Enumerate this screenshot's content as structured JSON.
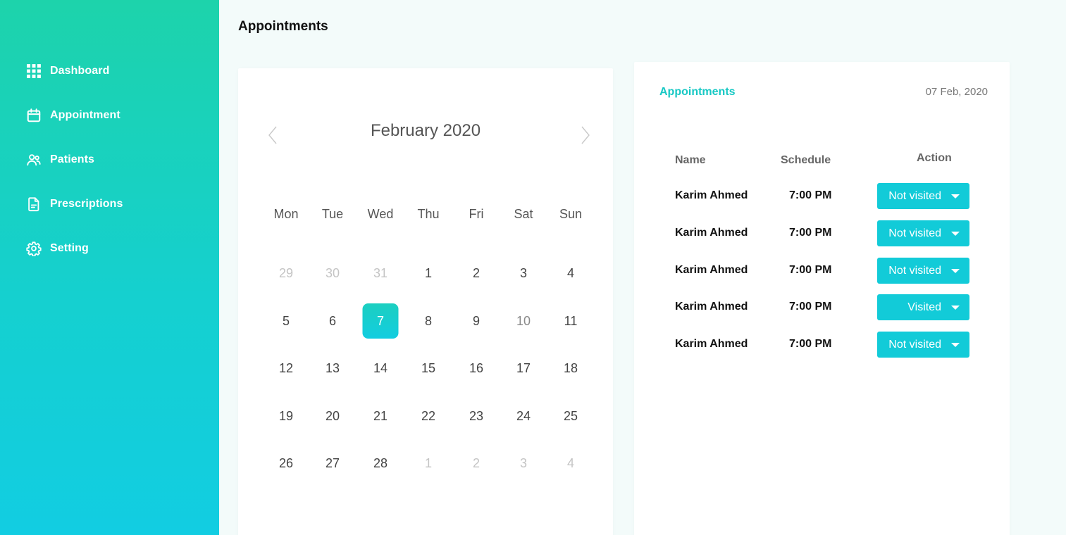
{
  "sidebar": {
    "items": [
      {
        "label": "Dashboard",
        "icon": "grid-icon"
      },
      {
        "label": "Appointment",
        "icon": "calendar-icon"
      },
      {
        "label": "Patients",
        "icon": "users-icon"
      },
      {
        "label": "Prescriptions",
        "icon": "document-icon"
      },
      {
        "label": "Setting",
        "icon": "gear-icon"
      }
    ]
  },
  "page": {
    "title": "Appointments"
  },
  "calendar": {
    "month_label": "February 2020",
    "weekdays": [
      "Mon",
      "Tue",
      "Wed",
      "Thu",
      "Fri",
      "Sat",
      "Sun"
    ],
    "selected_day": "7",
    "weeks": [
      [
        "29",
        "30",
        "31",
        "1",
        "2",
        "3",
        "4"
      ],
      [
        "5",
        "6",
        "7",
        "8",
        "9",
        "10",
        "11"
      ],
      [
        "12",
        "13",
        "14",
        "15",
        "16",
        "17",
        "18"
      ],
      [
        "19",
        "20",
        "21",
        "22",
        "23",
        "24",
        "25"
      ],
      [
        "26",
        "27",
        "28",
        "1",
        "2",
        "3",
        "4"
      ]
    ]
  },
  "appointments": {
    "title": "Appointments",
    "date": "07 Feb, 2020",
    "columns": {
      "name": "Name",
      "schedule": "Schedule",
      "action": "Action"
    },
    "rows": [
      {
        "name": "Karim Ahmed",
        "time": "7:00 PM",
        "status": "Not visited"
      },
      {
        "name": "Karim Ahmed",
        "time": "7:00 PM",
        "status": "Not visited"
      },
      {
        "name": "Karim Ahmed",
        "time": "7:00 PM",
        "status": "Not visited"
      },
      {
        "name": "Karim Ahmed",
        "time": "7:00 PM",
        "status": "Visited"
      },
      {
        "name": "Karim Ahmed",
        "time": "7:00 PM",
        "status": "Not visited"
      }
    ]
  },
  "colors": {
    "sidebar_top": "#1dd3ab",
    "sidebar_bottom": "#12cde2",
    "accent": "#17c8c4",
    "button": "#12cbd8"
  }
}
